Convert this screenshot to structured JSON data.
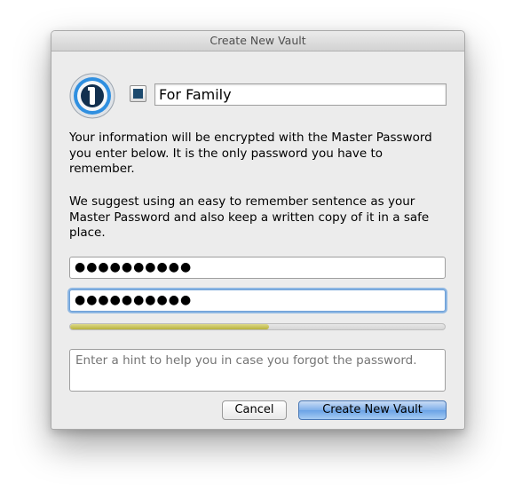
{
  "window": {
    "title": "Create New Vault"
  },
  "vault": {
    "icon": "1password-keyhole-icon",
    "color_swatch": "#1d4a6e",
    "name_value": "For Family"
  },
  "info": {
    "paragraph_1": "Your information will be encrypted with the Master Password you enter below. It is the only password you have to remember.",
    "paragraph_2": "We suggest using an easy to remember sentence as your Master Password and also keep a written copy of it in a safe place."
  },
  "password": {
    "value_masked": "●●●●●●●●●●",
    "confirm_masked": "●●●●●●●●●●"
  },
  "strength": {
    "fraction": 0.53,
    "color": "#c9c45a"
  },
  "hint": {
    "placeholder": "Enter a hint to help you in case you forgot the password."
  },
  "buttons": {
    "cancel_label": "Cancel",
    "create_label": "Create New Vault"
  }
}
